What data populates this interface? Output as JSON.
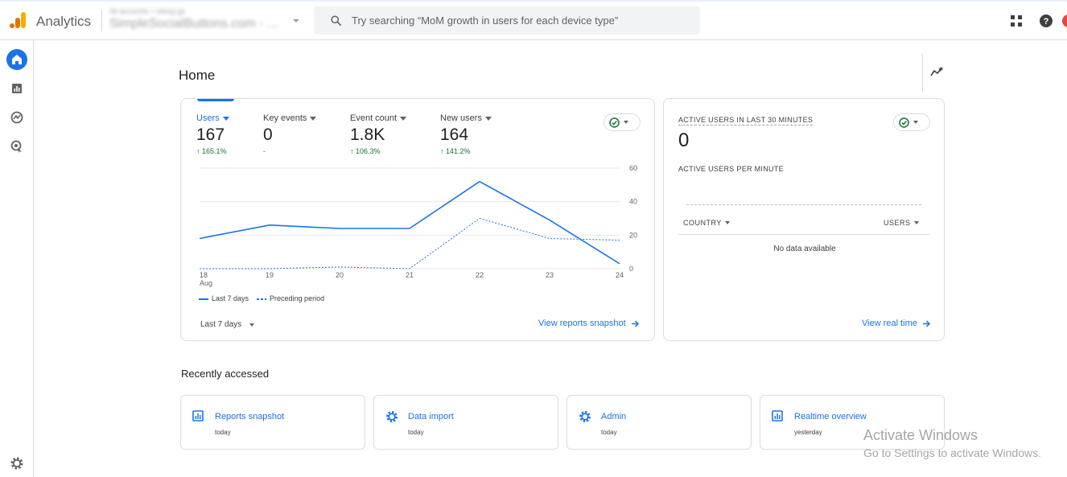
{
  "app": {
    "title": "Analytics"
  },
  "account": {
    "small": "All accounts > sitesp.gs",
    "name": "SimpleSocialButtons.com - ..."
  },
  "search": {
    "placeholder": "Try searching “MoM growth in users for each device type”"
  },
  "page": {
    "title": "Home"
  },
  "metrics": [
    {
      "label": "Users",
      "value": "167",
      "change": "↑ 165.1%"
    },
    {
      "label": "Key events",
      "value": "0",
      "change": "-"
    },
    {
      "label": "Event count",
      "value": "1.8K",
      "change": "↑ 106.3%"
    },
    {
      "label": "New users",
      "value": "164",
      "change": "↑ 141.2%"
    }
  ],
  "chart_data": {
    "type": "line",
    "x": [
      "18",
      "19",
      "20",
      "21",
      "22",
      "23",
      "24"
    ],
    "x_sublabel": "Aug",
    "series": [
      {
        "name": "Last 7 days",
        "style": "solid",
        "values": [
          18,
          26,
          24,
          24,
          52,
          29,
          3
        ]
      },
      {
        "name": "Preceding period",
        "style": "dashed",
        "values": [
          0,
          0,
          1,
          0,
          30,
          18,
          17
        ]
      }
    ],
    "y_ticks": [
      "60",
      "40",
      "20",
      "0"
    ],
    "ylim": [
      0,
      60
    ],
    "grid": true,
    "legend_position": "bottom-left",
    "color": "#1a73e8"
  },
  "main_card": {
    "period": "Last 7 days",
    "link": "View reports snapshot"
  },
  "realtime": {
    "title": "ACTIVE USERS IN LAST 30 MINUTES",
    "value": "0",
    "subtitle": "ACTIVE USERS PER MINUTE",
    "col_country": "COUNTRY",
    "col_users": "USERS",
    "empty": "No data available",
    "link": "View real time"
  },
  "recent": {
    "title": "Recently accessed",
    "items": [
      {
        "name": "Reports snapshot",
        "when": "today",
        "icon": "report-icon"
      },
      {
        "name": "Data import",
        "when": "today",
        "icon": "gear-icon"
      },
      {
        "name": "Admin",
        "when": "today",
        "icon": "gear-icon"
      },
      {
        "name": "Realtime overview",
        "when": "yesterday",
        "icon": "report-icon"
      }
    ]
  },
  "watermark": {
    "line1": "Activate Windows",
    "line2": "Go to Settings to activate Windows."
  },
  "colors": {
    "accent": "#1a73e8",
    "positive": "#137333",
    "logo_orange": "#f9ab00",
    "logo_dark": "#e37400"
  }
}
